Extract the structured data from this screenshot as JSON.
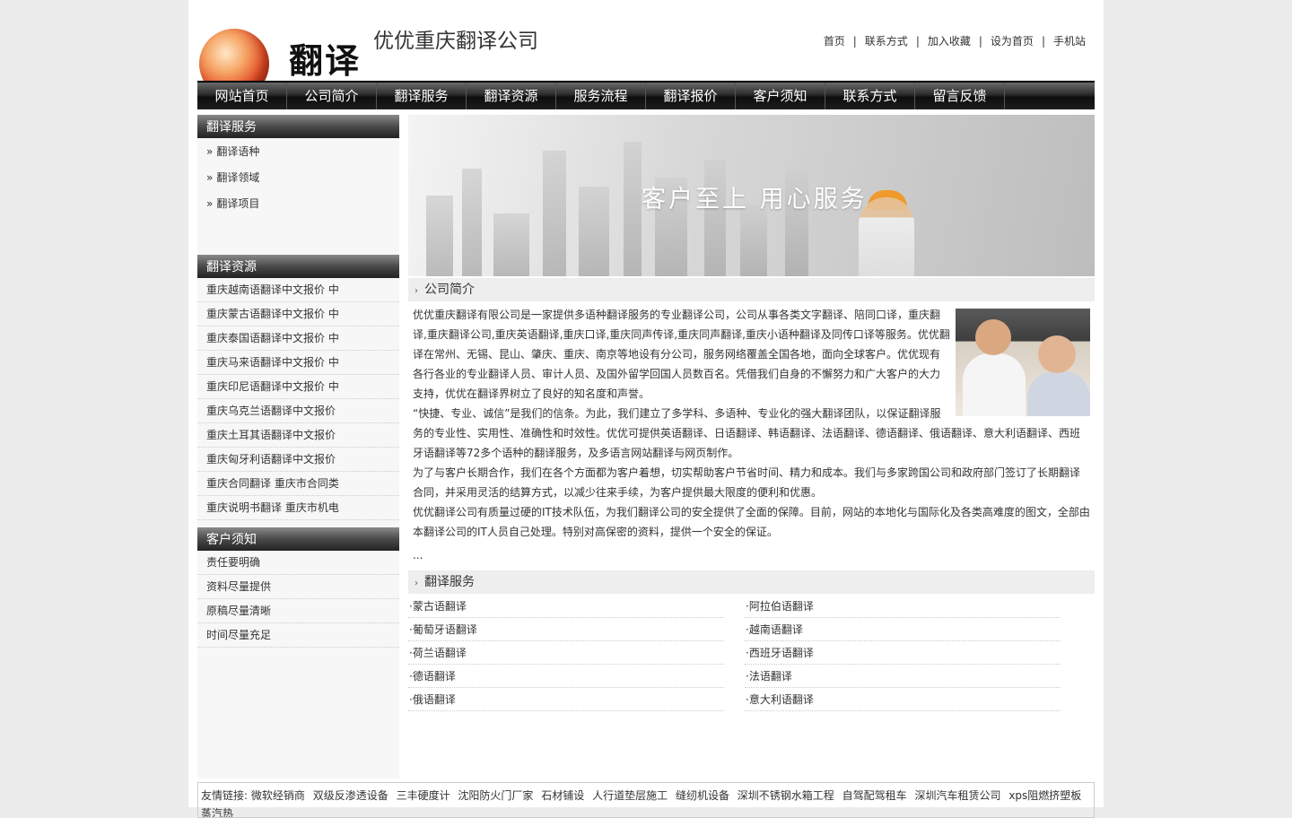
{
  "header": {
    "logo_text": "翻译",
    "site_title": "优优重庆翻译公司",
    "top_links": [
      "首页",
      "联系方式",
      "加入收藏",
      "设为首页",
      "手机站"
    ]
  },
  "nav": [
    "网站首页",
    "公司简介",
    "翻译服务",
    "翻译资源",
    "服务流程",
    "翻译报价",
    "客户须知",
    "联系方式",
    "留言反馈"
  ],
  "sidebar": {
    "services": {
      "title": "翻译服务",
      "items": [
        "翻译语种",
        "翻译领域",
        "翻译项目"
      ]
    },
    "resources": {
      "title": "翻译资源",
      "items": [
        "重庆越南语翻译中文报价 中",
        "重庆蒙古语翻译中文报价 中",
        "重庆泰国语翻译中文报价 中",
        "重庆马来语翻译中文报价 中",
        "重庆印尼语翻译中文报价 中",
        "重庆乌克兰语翻译中文报价",
        "重庆土耳其语翻译中文报价",
        "重庆匈牙利语翻译中文报价",
        "重庆合同翻译 重庆市合同类",
        "重庆说明书翻译 重庆市机电"
      ]
    },
    "notice": {
      "title": "客户须知",
      "items": [
        "责任要明确",
        "资料尽量提供",
        "原稿尽量清晰",
        "时间尽量充足"
      ]
    }
  },
  "banner": {
    "slogan": "客户至上 用心服务"
  },
  "about": {
    "title": "公司简介",
    "paragraphs": [
      "优优重庆翻译有限公司是一家提供多语种翻译服务的专业翻译公司，公司从事各类文字翻译、陪同口译，重庆翻译,重庆翻译公司,重庆英语翻译,重庆口译,重庆同声传译,重庆同声翻译,重庆小语种翻译及同传口译等服务。优优翻译在常州、无锡、昆山、肇庆、重庆、南京等地设有分公司，服务网络覆盖全国各地，面向全球客户。优优现有各行各业的专业翻译人员、审计人员、及国外留学回国人员数百名。凭借我们自身的不懈努力和广大客户的大力支持，优优在翻译界树立了良好的知名度和声誉。",
      "“快捷、专业、诚信”是我们的信条。为此，我们建立了多学科、多语种、专业化的强大翻译团队，以保证翻译服务的专业性、实用性、准确性和时效性。优优可提供英语翻译、日语翻译、韩语翻译、法语翻译、德语翻译、俄语翻译、意大利语翻译、西班牙语翻译等72多个语种的翻译服务，及多语言网站翻译与网页制作。",
      "为了与客户长期合作，我们在各个方面都为客户着想，切实帮助客户节省时间、精力和成本。我们与多家跨国公司和政府部门签订了长期翻译合同，并采用灵活的结算方式，以减少往来手续，为客户提供最大限度的便利和优惠。",
      "优优翻译公司有质量过硬的IT技术队伍，为我们翻译公司的安全提供了全面的保障。目前，网站的本地化与国际化及各类高难度的图文，全部由本翻译公司的IT人员自己处理。特别对高保密的资料，提供一个安全的保证。"
    ],
    "more": "..."
  },
  "services_section": {
    "title": "翻译服务",
    "items": [
      "·蒙古语翻译",
      "·阿拉伯语翻译",
      "·葡萄牙语翻译",
      "·越南语翻译",
      "·荷兰语翻译",
      "·西班牙语翻译",
      "·德语翻译",
      "·法语翻译",
      "·俄语翻译",
      "·意大利语翻译"
    ]
  },
  "footer": {
    "label": "友情链接:",
    "links": [
      "微软经销商",
      "双级反渗透设备",
      "三丰硬度计",
      "沈阳防火门厂家",
      "石材铺设",
      "人行道垫层施工",
      "缝纫机设备",
      "深圳不锈钢水箱工程",
      "自驾配驾租车",
      "深圳汽车租赁公司",
      "xps阻燃挤塑板",
      "蒸汽热"
    ]
  }
}
